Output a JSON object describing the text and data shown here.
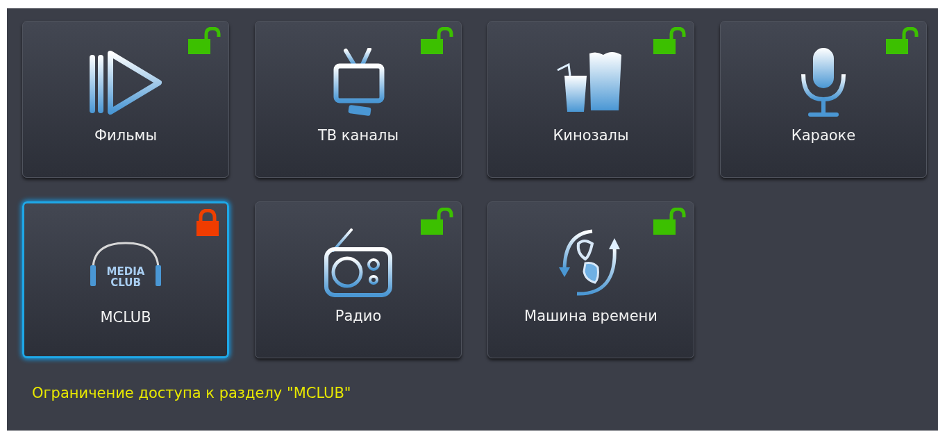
{
  "tiles": [
    {
      "label": "Фильмы",
      "kind": "play",
      "locked": false,
      "selected": false
    },
    {
      "label": "ТВ каналы",
      "kind": "tv",
      "locked": false,
      "selected": false
    },
    {
      "label": "Кинозалы",
      "kind": "cinema",
      "locked": false,
      "selected": false
    },
    {
      "label": "Караоке",
      "kind": "mic",
      "locked": false,
      "selected": false
    },
    {
      "label": "MCLUB",
      "kind": "logo",
      "logo_text": [
        "MEDIA",
        "CLUB"
      ],
      "locked": true,
      "selected": true
    },
    {
      "label": "Радио",
      "kind": "radio",
      "locked": false,
      "selected": false
    },
    {
      "label": "Машина времени",
      "kind": "time",
      "locked": false,
      "selected": false
    }
  ],
  "message": "Ограничение доступа к разделу \"MCLUB\""
}
